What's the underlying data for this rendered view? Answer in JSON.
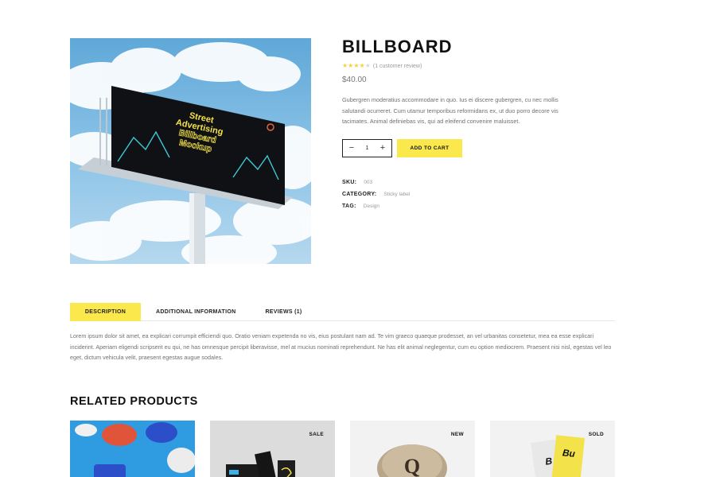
{
  "product": {
    "title": "BILLBOARD",
    "rating": {
      "value": 4,
      "max": 5,
      "review_text": "(1 customer review)"
    },
    "price": "$40.00",
    "short_description": "Gubergren moderatius accommodare in quo. Ius ei discere gubergren, cu nec mollis salutandi ocurreret. Cum utamur temporibus reformidans ex, ut duo porro decore vis tacimates. Animal definiebas vis, qui ad eleifend convenire maluisset.",
    "quantity": "1",
    "add_to_cart_label": "ADD TO CART",
    "meta": {
      "sku_label": "SKU:",
      "sku_value": "003",
      "category_label": "CATEGORY:",
      "category_value": "Sticky label",
      "tag_label": "TAG:",
      "tag_value": "Design"
    },
    "image": {
      "billboard_lines": [
        "Street",
        "Advertising",
        "Billboard",
        "Mockup"
      ]
    }
  },
  "tabs": [
    {
      "label": "DESCRIPTION",
      "active": true
    },
    {
      "label": "ADDITIONAL INFORMATION",
      "active": false
    },
    {
      "label": "REVIEWS (1)",
      "active": false
    }
  ],
  "description_text": "Lorem ipsum dolor sit amet, ea explicari corrumpit efficiendi quo. Oratio veniam expetenda no vis, eius postulant nam ad. Te vim graeco quaeque prodesset, an vel urbanitas consetetur, mea ea esse explicari inciderint. Aperiam eligendi scripserit eu qui, ne has omnesque percipit liberavisse, mel at mucius nominati reprehendunt. Ne has elit animal neglegentur, cum eu option mediocrem. Praesent nisi nisl, egestas vel leo eget, dictum vehicula velit, praesent egestas augue sodales.",
  "related": {
    "title": "RELATED PRODUCTS",
    "cards": [
      {
        "badge": ""
      },
      {
        "badge": "SALE"
      },
      {
        "badge": "NEW"
      },
      {
        "badge": "SOLD"
      }
    ]
  },
  "colors": {
    "accent": "#fbe84c",
    "star": "#f5d33b"
  }
}
